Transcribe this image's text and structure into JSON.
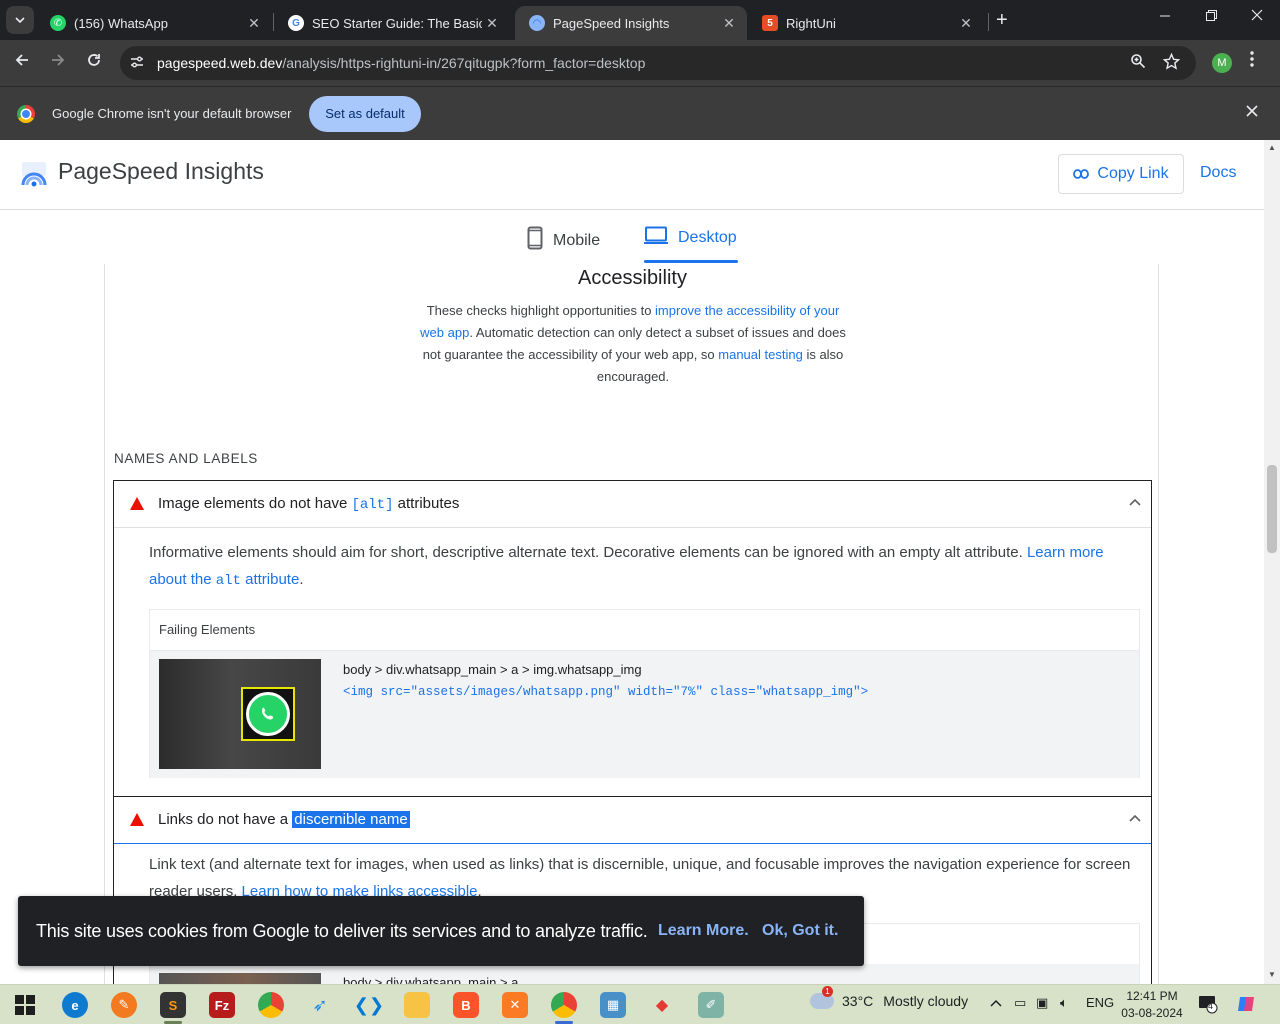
{
  "browser": {
    "tabs": [
      {
        "title": "(156) WhatsApp",
        "icon": "whatsapp-icon"
      },
      {
        "title": "SEO Starter Guide: The Basics | G",
        "icon": "google-icon"
      },
      {
        "title": "PageSpeed Insights",
        "icon": "pagespeed-icon",
        "active": true
      },
      {
        "title": "RightUni",
        "icon": "html5-icon"
      }
    ],
    "tab_close": "✕",
    "new_tab": "+",
    "url_host": "pagespeed.web.dev",
    "url_path": "/analysis/https-rightuni-in/267qitugpk?form_factor=desktop",
    "profile_initial": "M"
  },
  "infobar": {
    "message": "Google Chrome isn't your default browser",
    "button": "Set as default"
  },
  "header": {
    "title": "PageSpeed Insights",
    "copy_link": "Copy Link",
    "docs": "Docs"
  },
  "form_factor": {
    "mobile": "Mobile",
    "desktop": "Desktop",
    "selected": "desktop"
  },
  "section": {
    "title": "Accessibility",
    "desc_1": "These checks highlight opportunities to ",
    "desc_link_1": "improve the accessibility of your web app",
    "desc_2": ". Automatic detection can only detect a subset of issues and does not guarantee the accessibility of your web app, so ",
    "desc_link_2": "manual testing",
    "desc_3": " is also encouraged."
  },
  "group": {
    "title": "NAMES AND LABELS"
  },
  "audits": [
    {
      "title_before": "Image elements do not have ",
      "title_code": "[alt]",
      "title_after": " attributes",
      "desc": "Informative elements should aim for short, descriptive alternate text. Decorative elements can be ignored with an empty alt attribute. ",
      "desc_link_a": "Learn more about the ",
      "desc_link_code": "alt",
      "desc_link_b": " attribute",
      "desc_end": ".",
      "table_header": "Failing Elements",
      "node_path": "body > div.whatsapp_main > a > img.whatsapp_img",
      "node_snippet": "<img src=\"assets/images/whatsapp.png\" width=\"7%\" class=\"whatsapp_img\">"
    },
    {
      "title_before": "Links do not have a ",
      "title_selected": "discernible name",
      "desc": "Link text (and alternate text for images, when used as links) that is discernible, unique, and focusable improves the navigation experience for screen reader users. ",
      "desc_link": "Learn how to make links accessible",
      "desc_end": ".",
      "node_path": "body > div.whatsapp_main > a"
    }
  ],
  "cookie": {
    "message": "This site uses cookies from Google to deliver its services and to analyze traffic.",
    "learn_more": "Learn More.",
    "ok": "Ok, Got it."
  },
  "taskbar": {
    "weather_temp": "33°C",
    "weather_text": "Mostly cloudy",
    "weather_badge": "1",
    "language": "ENG",
    "time": "12:41 PM",
    "date": "03-08-2024",
    "notifications": "4"
  },
  "colors": {
    "accent": "#1a73e8",
    "fail": "#eb0f00",
    "chrome_dark": "#202124"
  }
}
